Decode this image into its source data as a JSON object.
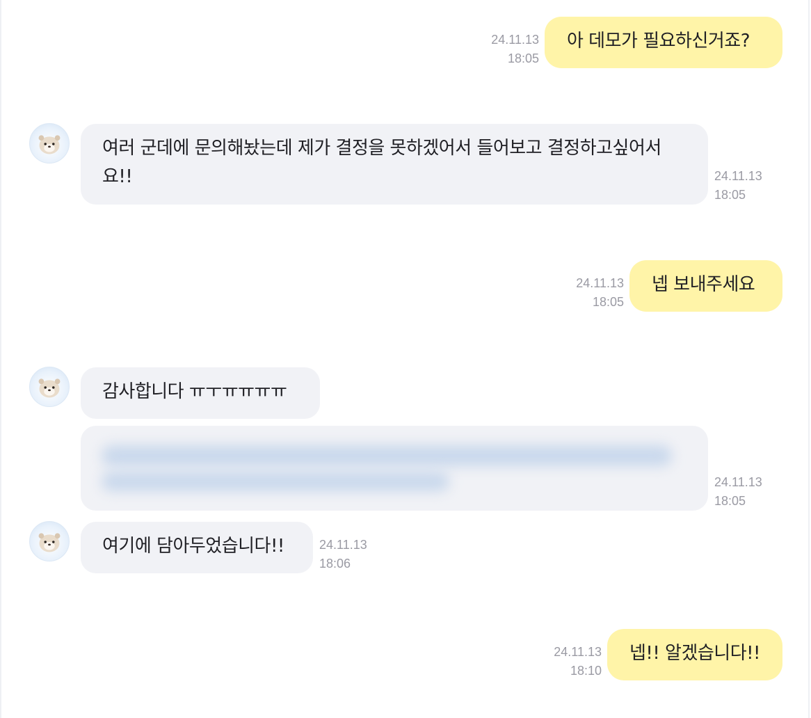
{
  "messages": [
    {
      "sender": "me",
      "text": "아 데모가 필요하신거죠?",
      "date": "24.11.13",
      "time": "18:05"
    },
    {
      "sender": "other",
      "text": "여러 군데에 문의해놨는데 제가 결정을 못하겠어서 들어보고 결정하고싶어서요!!",
      "date": "24.11.13",
      "time": "18:05"
    },
    {
      "sender": "me",
      "text": "넵 보내주세요",
      "date": "24.11.13",
      "time": "18:05"
    },
    {
      "sender": "other",
      "text": "감사합니다 ㅠㅜㅠㅠㅠㅠ"
    },
    {
      "sender": "other",
      "text": "",
      "redacted": true,
      "date": "24.11.13",
      "time": "18:05"
    },
    {
      "sender": "other",
      "text": "여기에 담아두었습니다!!",
      "date": "24.11.13",
      "time": "18:06"
    },
    {
      "sender": "me",
      "text": "넵!! 알겠습니다!!",
      "date": "24.11.13",
      "time": "18:10"
    }
  ],
  "colors": {
    "my_bubble": "#fff4a8",
    "other_bubble": "#f1f2f6",
    "timestamp": "#9a9aa3",
    "redacted_blur": "#c9d8ec"
  },
  "icons": {
    "avatar": "otter-avatar-icon"
  }
}
